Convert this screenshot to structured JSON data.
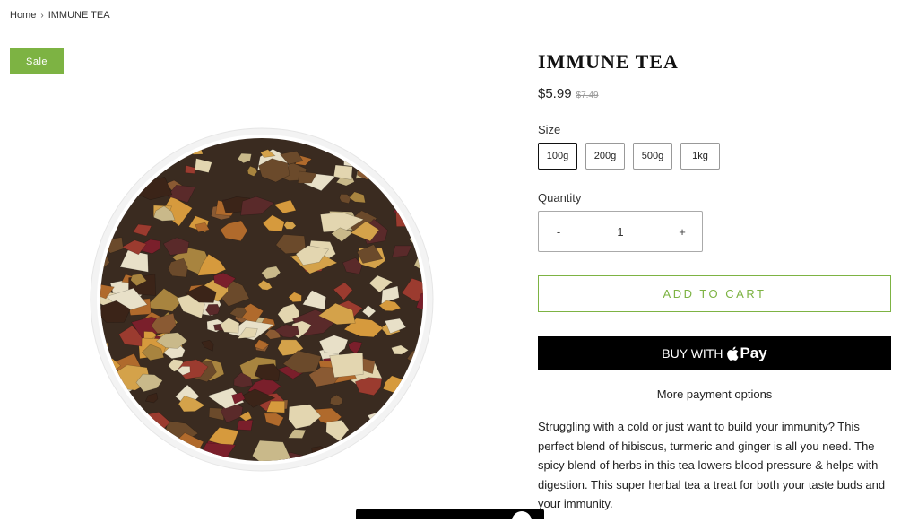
{
  "breadcrumb": {
    "home": "Home",
    "separator": "›",
    "current": "IMMUNE TEA"
  },
  "badge": {
    "label": "Sale",
    "color": "#7db343"
  },
  "product": {
    "title": "IMMUNE TEA",
    "price": "$5.99",
    "compare_price": "$7.49",
    "size_label": "Size",
    "sizes": [
      "100g",
      "200g",
      "500g",
      "1kg"
    ],
    "selected_size": "100g",
    "quantity_label": "Quantity",
    "quantity": {
      "decrement": "-",
      "value": "1",
      "increment": "+"
    },
    "add_to_cart": "ADD TO CART",
    "buy_with": "BUY WITH",
    "pay_brand": "Pay",
    "more_payment": "More payment options",
    "description": "Struggling with a cold or just want to build your immunity? This perfect blend of hibiscus, turmeric and ginger is all you need. The spicy blend of herbs in this tea lowers blood pressure & helps with digestion. This super herbal tea a treat for both your taste buds and your immunity."
  },
  "colors": {
    "accent": "#7db343",
    "buy_button": "#000000"
  }
}
